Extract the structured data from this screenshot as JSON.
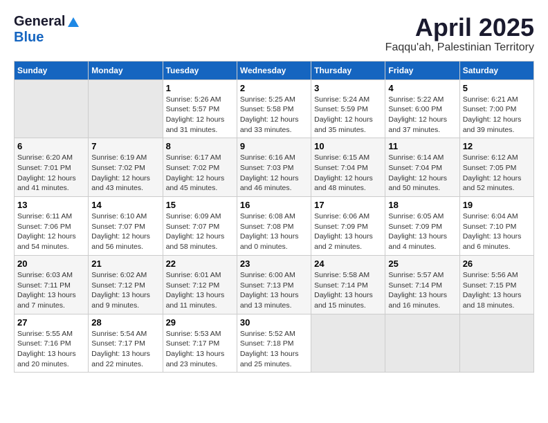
{
  "logo": {
    "general": "General",
    "blue": "Blue"
  },
  "title": "April 2025",
  "subtitle": "Faqqu'ah, Palestinian Territory",
  "days_of_week": [
    "Sunday",
    "Monday",
    "Tuesday",
    "Wednesday",
    "Thursday",
    "Friday",
    "Saturday"
  ],
  "weeks": [
    [
      {
        "day": "",
        "detail": ""
      },
      {
        "day": "",
        "detail": ""
      },
      {
        "day": "1",
        "detail": "Sunrise: 5:26 AM\nSunset: 5:57 PM\nDaylight: 12 hours\nand 31 minutes."
      },
      {
        "day": "2",
        "detail": "Sunrise: 5:25 AM\nSunset: 5:58 PM\nDaylight: 12 hours\nand 33 minutes."
      },
      {
        "day": "3",
        "detail": "Sunrise: 5:24 AM\nSunset: 5:59 PM\nDaylight: 12 hours\nand 35 minutes."
      },
      {
        "day": "4",
        "detail": "Sunrise: 5:22 AM\nSunset: 6:00 PM\nDaylight: 12 hours\nand 37 minutes."
      },
      {
        "day": "5",
        "detail": "Sunrise: 6:21 AM\nSunset: 7:00 PM\nDaylight: 12 hours\nand 39 minutes."
      }
    ],
    [
      {
        "day": "6",
        "detail": "Sunrise: 6:20 AM\nSunset: 7:01 PM\nDaylight: 12 hours\nand 41 minutes."
      },
      {
        "day": "7",
        "detail": "Sunrise: 6:19 AM\nSunset: 7:02 PM\nDaylight: 12 hours\nand 43 minutes."
      },
      {
        "day": "8",
        "detail": "Sunrise: 6:17 AM\nSunset: 7:02 PM\nDaylight: 12 hours\nand 45 minutes."
      },
      {
        "day": "9",
        "detail": "Sunrise: 6:16 AM\nSunset: 7:03 PM\nDaylight: 12 hours\nand 46 minutes."
      },
      {
        "day": "10",
        "detail": "Sunrise: 6:15 AM\nSunset: 7:04 PM\nDaylight: 12 hours\nand 48 minutes."
      },
      {
        "day": "11",
        "detail": "Sunrise: 6:14 AM\nSunset: 7:04 PM\nDaylight: 12 hours\nand 50 minutes."
      },
      {
        "day": "12",
        "detail": "Sunrise: 6:12 AM\nSunset: 7:05 PM\nDaylight: 12 hours\nand 52 minutes."
      }
    ],
    [
      {
        "day": "13",
        "detail": "Sunrise: 6:11 AM\nSunset: 7:06 PM\nDaylight: 12 hours\nand 54 minutes."
      },
      {
        "day": "14",
        "detail": "Sunrise: 6:10 AM\nSunset: 7:07 PM\nDaylight: 12 hours\nand 56 minutes."
      },
      {
        "day": "15",
        "detail": "Sunrise: 6:09 AM\nSunset: 7:07 PM\nDaylight: 12 hours\nand 58 minutes."
      },
      {
        "day": "16",
        "detail": "Sunrise: 6:08 AM\nSunset: 7:08 PM\nDaylight: 13 hours\nand 0 minutes."
      },
      {
        "day": "17",
        "detail": "Sunrise: 6:06 AM\nSunset: 7:09 PM\nDaylight: 13 hours\nand 2 minutes."
      },
      {
        "day": "18",
        "detail": "Sunrise: 6:05 AM\nSunset: 7:09 PM\nDaylight: 13 hours\nand 4 minutes."
      },
      {
        "day": "19",
        "detail": "Sunrise: 6:04 AM\nSunset: 7:10 PM\nDaylight: 13 hours\nand 6 minutes."
      }
    ],
    [
      {
        "day": "20",
        "detail": "Sunrise: 6:03 AM\nSunset: 7:11 PM\nDaylight: 13 hours\nand 7 minutes."
      },
      {
        "day": "21",
        "detail": "Sunrise: 6:02 AM\nSunset: 7:12 PM\nDaylight: 13 hours\nand 9 minutes."
      },
      {
        "day": "22",
        "detail": "Sunrise: 6:01 AM\nSunset: 7:12 PM\nDaylight: 13 hours\nand 11 minutes."
      },
      {
        "day": "23",
        "detail": "Sunrise: 6:00 AM\nSunset: 7:13 PM\nDaylight: 13 hours\nand 13 minutes."
      },
      {
        "day": "24",
        "detail": "Sunrise: 5:58 AM\nSunset: 7:14 PM\nDaylight: 13 hours\nand 15 minutes."
      },
      {
        "day": "25",
        "detail": "Sunrise: 5:57 AM\nSunset: 7:14 PM\nDaylight: 13 hours\nand 16 minutes."
      },
      {
        "day": "26",
        "detail": "Sunrise: 5:56 AM\nSunset: 7:15 PM\nDaylight: 13 hours\nand 18 minutes."
      }
    ],
    [
      {
        "day": "27",
        "detail": "Sunrise: 5:55 AM\nSunset: 7:16 PM\nDaylight: 13 hours\nand 20 minutes."
      },
      {
        "day": "28",
        "detail": "Sunrise: 5:54 AM\nSunset: 7:17 PM\nDaylight: 13 hours\nand 22 minutes."
      },
      {
        "day": "29",
        "detail": "Sunrise: 5:53 AM\nSunset: 7:17 PM\nDaylight: 13 hours\nand 23 minutes."
      },
      {
        "day": "30",
        "detail": "Sunrise: 5:52 AM\nSunset: 7:18 PM\nDaylight: 13 hours\nand 25 minutes."
      },
      {
        "day": "",
        "detail": ""
      },
      {
        "day": "",
        "detail": ""
      },
      {
        "day": "",
        "detail": ""
      }
    ]
  ]
}
